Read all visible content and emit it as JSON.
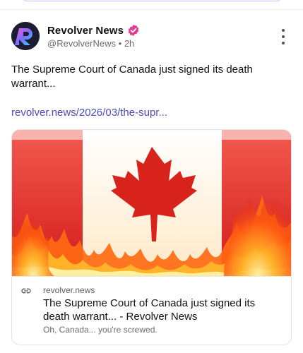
{
  "colors": {
    "accent_link": "#4c4bbd",
    "verified_badge": "#e23d8f",
    "text_primary": "#111111",
    "text_secondary": "#6b6b6b"
  },
  "post": {
    "author_name": "Revolver News",
    "handle": "@RevolverNews",
    "separator": "•",
    "timestamp": "2h",
    "text": "The Supreme Court of Canada just signed its death warrant...",
    "link": "revolver.news/2026/03/the-supr...",
    "icons": [
      "avatar-logo",
      "verified-badge-icon",
      "more-options-icon"
    ]
  },
  "link_card": {
    "domain": "revolver.news",
    "title": "The Supreme Court of Canada just signed its death warrant... - Revolver News",
    "description": "Oh, Canada... you're screwed.",
    "image_subject": "canada-flag-in-flames",
    "icon": "link-icon"
  }
}
